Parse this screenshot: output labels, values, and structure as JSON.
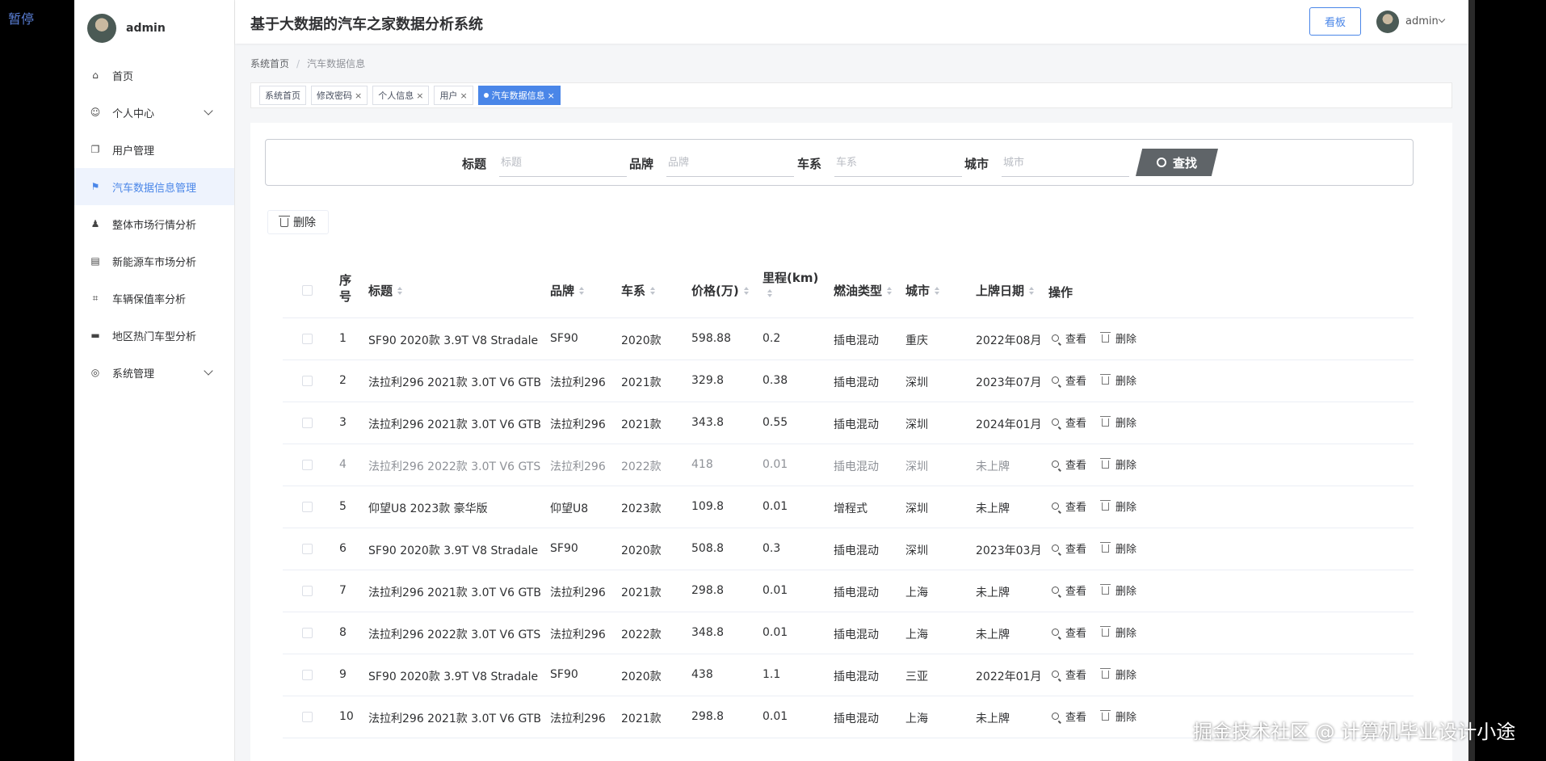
{
  "overlay": {
    "pause_label": "暂停",
    "watermark": "掘金技术社区 @ 计算机毕业设计小途"
  },
  "sidebar": {
    "user": "admin",
    "items": [
      {
        "label": "首页",
        "icon": "home-icon"
      },
      {
        "label": "个人中心",
        "icon": "user-icon",
        "expandable": true
      },
      {
        "label": "用户管理",
        "icon": "copy-icon"
      },
      {
        "label": "汽车数据信息管理",
        "icon": "flag-icon",
        "active": true
      },
      {
        "label": "整体市场行情分析",
        "icon": "stamp-icon"
      },
      {
        "label": "新能源车市场分析",
        "icon": "card-icon"
      },
      {
        "label": "车辆保值率分析",
        "icon": "crop-icon"
      },
      {
        "label": "地区热门车型分析",
        "icon": "printer-icon"
      },
      {
        "label": "系统管理",
        "icon": "settings-icon",
        "expandable": true
      }
    ]
  },
  "header": {
    "title": "基于大数据的汽车之家数据分析系统",
    "board_label": "看板",
    "user": "admin"
  },
  "breadcrumb": {
    "home": "系统首页",
    "separator": "/",
    "current": "汽车数据信息"
  },
  "tags": [
    {
      "label": "系统首页",
      "closable": false
    },
    {
      "label": "修改密码",
      "closable": true
    },
    {
      "label": "个人信息",
      "closable": true
    },
    {
      "label": "用户",
      "closable": true
    },
    {
      "label": "汽车数据信息",
      "closable": true,
      "active": true
    }
  ],
  "search": {
    "title_label": "标题",
    "title_placeholder": "标题",
    "brand_label": "品牌",
    "brand_placeholder": "品牌",
    "series_label": "车系",
    "series_placeholder": "车系",
    "city_label": "城市",
    "city_placeholder": "城市",
    "button": "查找"
  },
  "actions": {
    "delete_label": "删除",
    "view_label": "查看"
  },
  "table": {
    "headers": {
      "index": "序号",
      "title": "标题",
      "brand": "品牌",
      "series": "车系",
      "price": "价格(万)",
      "mileage": "里程(km)",
      "fuel": "燃油类型",
      "city": "城市",
      "reg_date": "上牌日期",
      "ops": "操作"
    },
    "rows": [
      {
        "index": "1",
        "title": "SF90 2020款 3.9T V8 Stradale",
        "brand": "SF90",
        "series": "2020款",
        "price": "598.88",
        "mileage": "0.2",
        "fuel": "插电混动",
        "city": "重庆",
        "reg_date": "2022年08月"
      },
      {
        "index": "2",
        "title": "法拉利296 2021款 3.0T V6 GTB",
        "brand": "法拉利296",
        "series": "2021款",
        "price": "329.8",
        "mileage": "0.38",
        "fuel": "插电混动",
        "city": "深圳",
        "reg_date": "2023年07月"
      },
      {
        "index": "3",
        "title": "法拉利296 2021款 3.0T V6 GTB",
        "brand": "法拉利296",
        "series": "2021款",
        "price": "343.8",
        "mileage": "0.55",
        "fuel": "插电混动",
        "city": "深圳",
        "reg_date": "2024年01月"
      },
      {
        "index": "4",
        "title": "法拉利296 2022款 3.0T V6 GTS",
        "brand": "法拉利296",
        "series": "2022款",
        "price": "418",
        "mileage": "0.01",
        "fuel": "插电混动",
        "city": "深圳",
        "reg_date": "未上牌",
        "dim": true
      },
      {
        "index": "5",
        "title": "仰望U8 2023款 豪华版",
        "brand": "仰望U8",
        "series": "2023款",
        "price": "109.8",
        "mileage": "0.01",
        "fuel": "增程式",
        "city": "深圳",
        "reg_date": "未上牌"
      },
      {
        "index": "6",
        "title": "SF90 2020款 3.9T V8 Stradale",
        "brand": "SF90",
        "series": "2020款",
        "price": "508.8",
        "mileage": "0.3",
        "fuel": "插电混动",
        "city": "深圳",
        "reg_date": "2023年03月"
      },
      {
        "index": "7",
        "title": "法拉利296 2021款 3.0T V6 GTB",
        "brand": "法拉利296",
        "series": "2021款",
        "price": "298.8",
        "mileage": "0.01",
        "fuel": "插电混动",
        "city": "上海",
        "reg_date": "未上牌"
      },
      {
        "index": "8",
        "title": "法拉利296 2022款 3.0T V6 GTS",
        "brand": "法拉利296",
        "series": "2022款",
        "price": "348.8",
        "mileage": "0.01",
        "fuel": "插电混动",
        "city": "上海",
        "reg_date": "未上牌"
      },
      {
        "index": "9",
        "title": "SF90 2020款 3.9T V8 Stradale",
        "brand": "SF90",
        "series": "2020款",
        "price": "438",
        "mileage": "1.1",
        "fuel": "插电混动",
        "city": "三亚",
        "reg_date": "2022年01月"
      },
      {
        "index": "10",
        "title": "法拉利296 2021款 3.0T V6 GTB",
        "brand": "法拉利296",
        "series": "2021款",
        "price": "298.8",
        "mileage": "0.01",
        "fuel": "插电混动",
        "city": "上海",
        "reg_date": "未上牌"
      }
    ]
  },
  "colors": {
    "accent": "#4a86e8",
    "search_button": "#5f6468",
    "active_menu_bg": "#eef3fd"
  }
}
